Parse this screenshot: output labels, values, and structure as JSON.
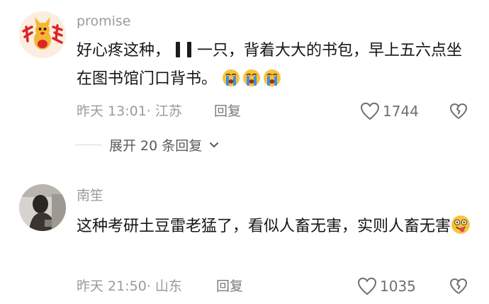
{
  "comments": [
    {
      "username": "promise",
      "text_before": "好心疼这种，",
      "text_after": "一只，背着大大的书包，早上五六点坐在图书馆门口背书。",
      "emojis": [
        "crying-face-emoji",
        "crying-face-emoji",
        "crying-face-emoji"
      ],
      "time_location": "昨天 13:01· 江苏",
      "reply_label": "回复",
      "like_count": "1744",
      "expand_label": "展开 20 条回复"
    },
    {
      "username": "南笙",
      "text": "这种考研土豆雷老猛了，看似人畜无害，实则人畜无害",
      "emojis": [
        "dizzy-tongue-face-emoji"
      ],
      "time_location": "昨天 21:50· 山东",
      "reply_label": "回复",
      "like_count": "1035"
    }
  ],
  "colors": {
    "meta_gray": "#9b9b9b",
    "text": "#161616",
    "avatar_red": "#d9262b",
    "avatar_yellow": "#f5b731",
    "emoji_yellow": "#f7c33b",
    "emoji_blue": "#3f8ef0"
  }
}
